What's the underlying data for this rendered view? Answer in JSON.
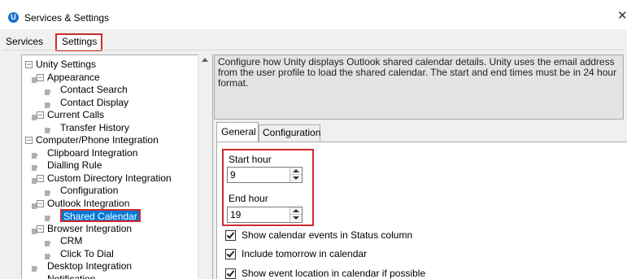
{
  "window": {
    "app_icon_glyph": "U",
    "title": "Services & Settings",
    "close_glyph": "✕"
  },
  "top_tabs": {
    "services": "Services",
    "settings": "Settings",
    "active": "Settings",
    "highlight_color": "#d12a2a"
  },
  "tree": {
    "items": [
      {
        "label": "Unity Settings",
        "level": 0,
        "toggle": "minus"
      },
      {
        "label": "Appearance",
        "level": 1,
        "toggle": "minus"
      },
      {
        "label": "Contact Search",
        "level": 2,
        "toggle": "none"
      },
      {
        "label": "Contact Display",
        "level": 2,
        "toggle": "none"
      },
      {
        "label": "Current Calls",
        "level": 1,
        "toggle": "minus"
      },
      {
        "label": "Transfer History",
        "level": 2,
        "toggle": "none"
      },
      {
        "label": "Computer/Phone Integration",
        "level": 0,
        "toggle": "minus"
      },
      {
        "label": "Clipboard Integration",
        "level": 1,
        "toggle": "none"
      },
      {
        "label": "Dialling Rule",
        "level": 1,
        "toggle": "none"
      },
      {
        "label": "Custom Directory Integration",
        "level": 1,
        "toggle": "minus"
      },
      {
        "label": "Configuration",
        "level": 2,
        "toggle": "none"
      },
      {
        "label": "Outlook Integration",
        "level": 1,
        "toggle": "minus"
      },
      {
        "label": "Shared Calendar",
        "level": 2,
        "toggle": "none",
        "selected": true
      },
      {
        "label": "Browser Integration",
        "level": 1,
        "toggle": "minus"
      },
      {
        "label": "CRM",
        "level": 2,
        "toggle": "none"
      },
      {
        "label": "Click To Dial",
        "level": 2,
        "toggle": "none"
      },
      {
        "label": "Desktop Integration",
        "level": 1,
        "toggle": "none"
      },
      {
        "label": "Notification",
        "level": 1,
        "toggle": "none"
      }
    ],
    "selected_color": "#0078d7"
  },
  "description": "Configure how Unity displays Outlook shared calendar details.  Unity uses the email address from the user profile to load the shared calendar.  The start and end times must be in 24 hour format.",
  "inner_tabs": {
    "general": "General",
    "configuration": "Configuration",
    "active": "General"
  },
  "fields": {
    "start_hour_label": "Start hour",
    "start_hour_value": "9",
    "end_hour_label": "End hour",
    "end_hour_value": "19"
  },
  "checkboxes": [
    {
      "label": "Show calendar events in Status column",
      "checked": true
    },
    {
      "label": "Include tomorrow in calendar",
      "checked": true
    },
    {
      "label": "Show event location in calendar if possible",
      "checked": true
    }
  ]
}
